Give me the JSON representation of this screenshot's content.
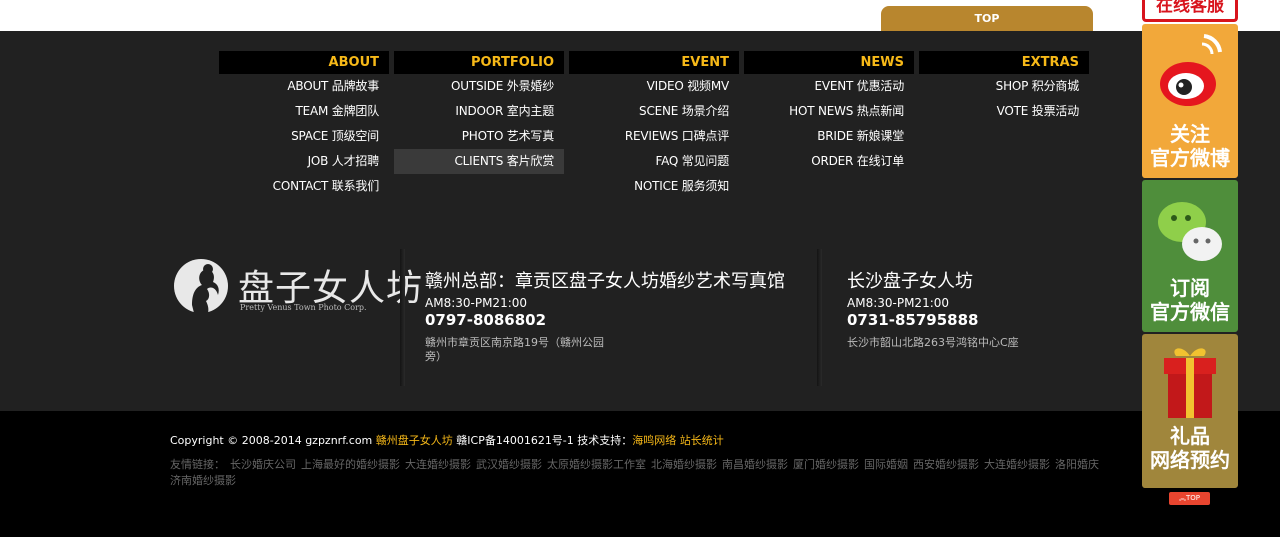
{
  "top_tab": "TOP",
  "nav": [
    {
      "title": "ABOUT",
      "items": [
        "ABOUT 品牌故事",
        "TEAM 金牌团队",
        "SPACE 顶级空间",
        "JOB 人才招聘",
        "CONTACT 联系我们"
      ]
    },
    {
      "title": "PORTFOLIO",
      "items": [
        "OUTSIDE 外景婚纱",
        "INDOOR 室内主题",
        "PHOTO 艺术写真",
        "CLIENTS 客片欣赏"
      ]
    },
    {
      "title": "EVENT",
      "items": [
        "VIDEO 视频MV",
        "SCENE 场景介绍",
        "REVIEWS 口碑点评",
        "FAQ 常见问题",
        "NOTICE 服务须知"
      ]
    },
    {
      "title": "NEWS",
      "items": [
        "EVENT 优惠活动",
        "HOT NEWS 热点新闻",
        "BRIDE 新娘课堂",
        "ORDER 在线订单"
      ]
    },
    {
      "title": "EXTRAS",
      "items": [
        "SHOP 积分商城",
        "VOTE 投票活动"
      ]
    }
  ],
  "logo": {
    "name": "盘子女人坊",
    "sub": "Pretty Venus Town Photo Corp."
  },
  "branches": [
    {
      "name": "赣州总部：章贡区盘子女人坊婚纱艺术写真馆",
      "hours": "AM8:30-PM21:00",
      "phone": "0797-8086802",
      "address": "赣州市章贡区南京路19号（赣州公园旁）"
    },
    {
      "name": "长沙盘子女人坊",
      "hours": "AM8:30-PM21:00",
      "phone": "0731-85795888",
      "address": "长沙市韶山北路263号鸿铭中心C座"
    }
  ],
  "copyright": {
    "text": "Copyright © 2008-2014 gzpznrf.com",
    "company": "赣州盘子女人坊",
    "icp": "赣ICP备14001621号-1 技术支持：",
    "support": "海鸣网络",
    "stats": "站长统计"
  },
  "friend_links": {
    "label": "友情链接：",
    "items": [
      "长沙婚庆公司",
      "上海最好的婚纱摄影",
      "大连婚纱摄影",
      "武汉婚纱摄影",
      "太原婚纱摄影工作室",
      "北海婚纱摄影",
      "南昌婚纱摄影",
      "厦门婚纱摄影",
      "国际婚姻",
      "西安婚纱摄影",
      "大连婚纱摄影",
      "洛阳婚庆",
      "济南婚纱摄影"
    ]
  },
  "side": {
    "online": "在线客服",
    "weibo": [
      "关注",
      "官方微博"
    ],
    "wechat": [
      "订阅",
      "官方微信"
    ],
    "gift": [
      "礼品",
      "网络预约"
    ],
    "top": "TOP"
  }
}
